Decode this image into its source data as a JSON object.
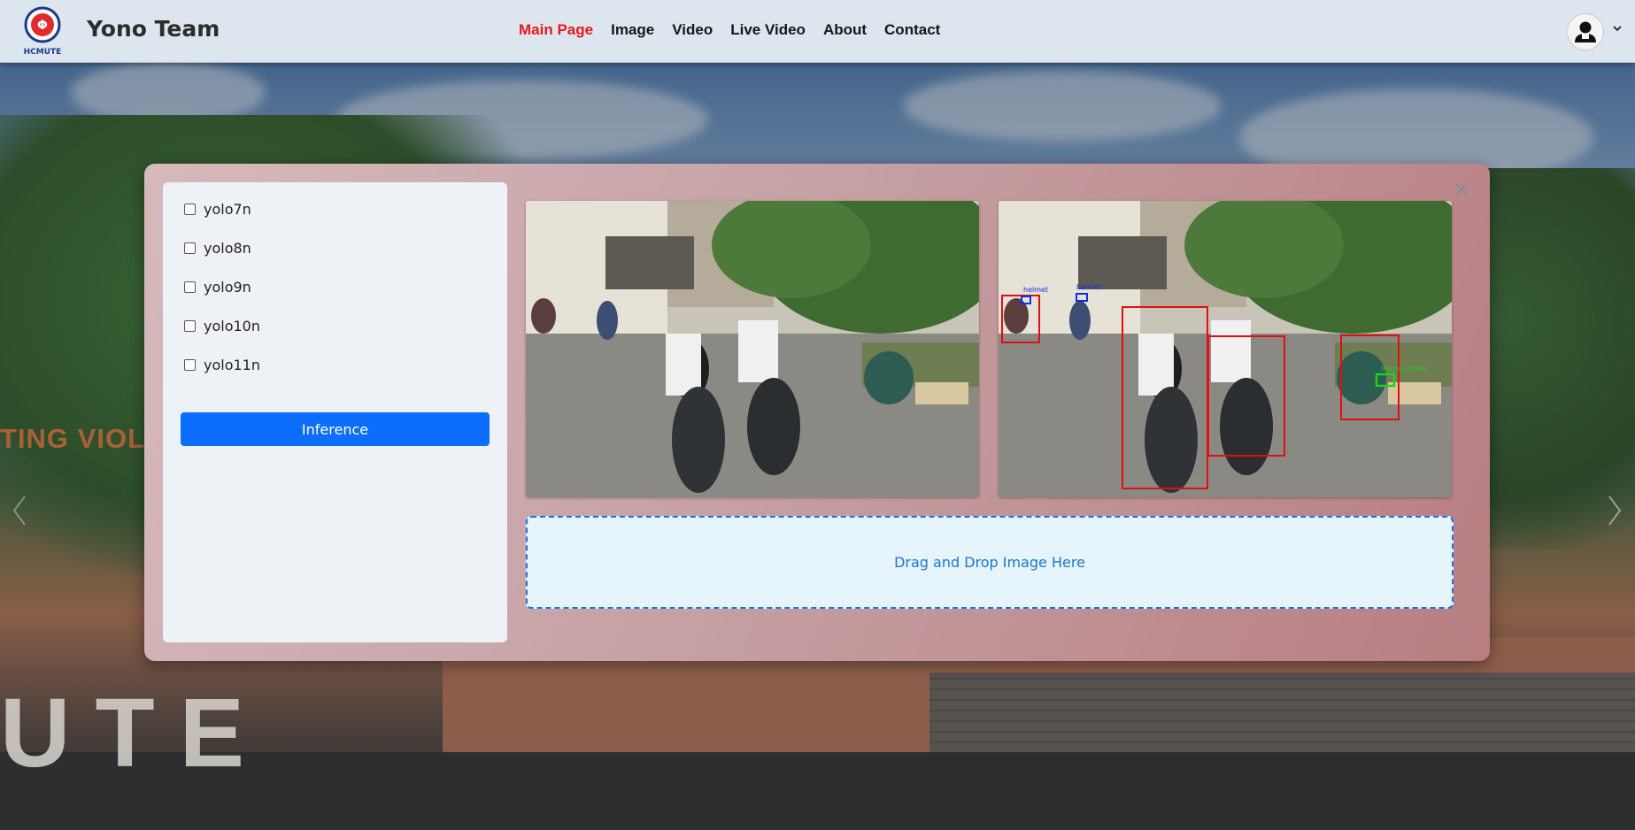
{
  "header": {
    "logo_text": "HCMUTE",
    "brand": "Yono Team",
    "nav": [
      {
        "label": "Main Page",
        "active": true
      },
      {
        "label": "Image",
        "active": false
      },
      {
        "label": "Video",
        "active": false
      },
      {
        "label": "Live Video",
        "active": false
      },
      {
        "label": "About",
        "active": false
      },
      {
        "label": "Contact",
        "active": false
      }
    ],
    "user_icon": "user-icon",
    "menu_icon": "chevron-down-icon"
  },
  "hero": {
    "side_text": "TING VIOLA",
    "campus_letters": "UTE"
  },
  "modal": {
    "models": [
      "yolo7n",
      "yolo8n",
      "yolo9n",
      "yolo10n",
      "yolo11n"
    ],
    "inference_label": "Inference",
    "dropzone_label": "Drag and Drop Image Here",
    "detections": [
      "helmet",
      "helmet",
      "helmet",
      "license_plate"
    ],
    "close_icon": "close-icon"
  },
  "colors": {
    "accent": "#0d6efd",
    "nav_active": "#e8171b",
    "box_no_helmet": "#e01010",
    "box_helmet": "#1030e0",
    "box_plate": "#1fd11f"
  }
}
